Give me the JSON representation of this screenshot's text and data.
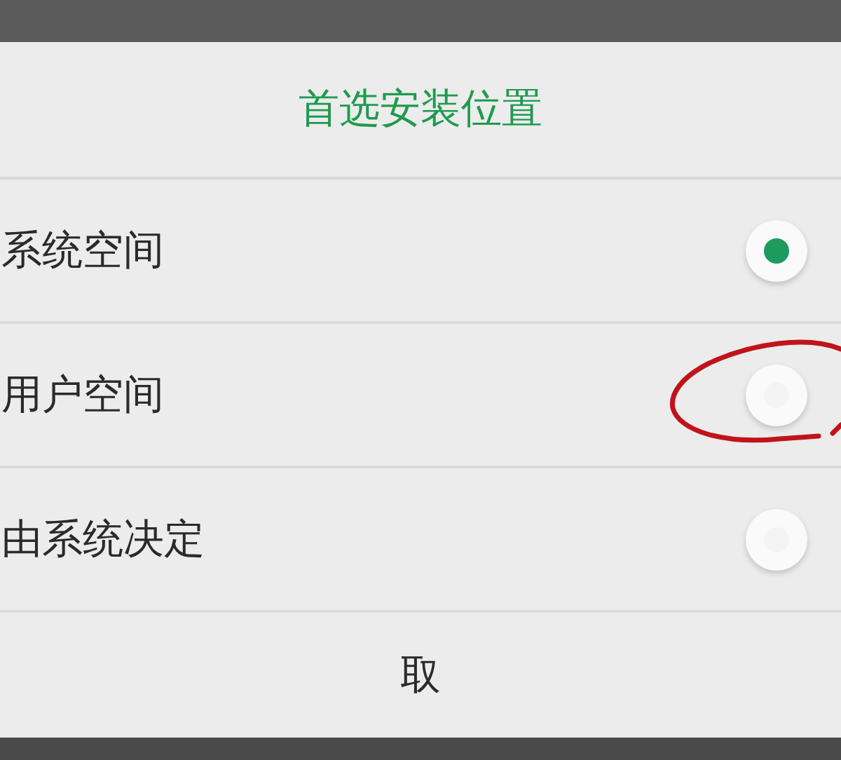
{
  "dialog": {
    "title": "首选安装位置",
    "options": [
      {
        "label": "系统空间",
        "selected": true
      },
      {
        "label": "用户空间",
        "selected": false,
        "annotated": true
      },
      {
        "label": "由系统决定",
        "selected": false
      }
    ],
    "cancel_button": "取"
  }
}
